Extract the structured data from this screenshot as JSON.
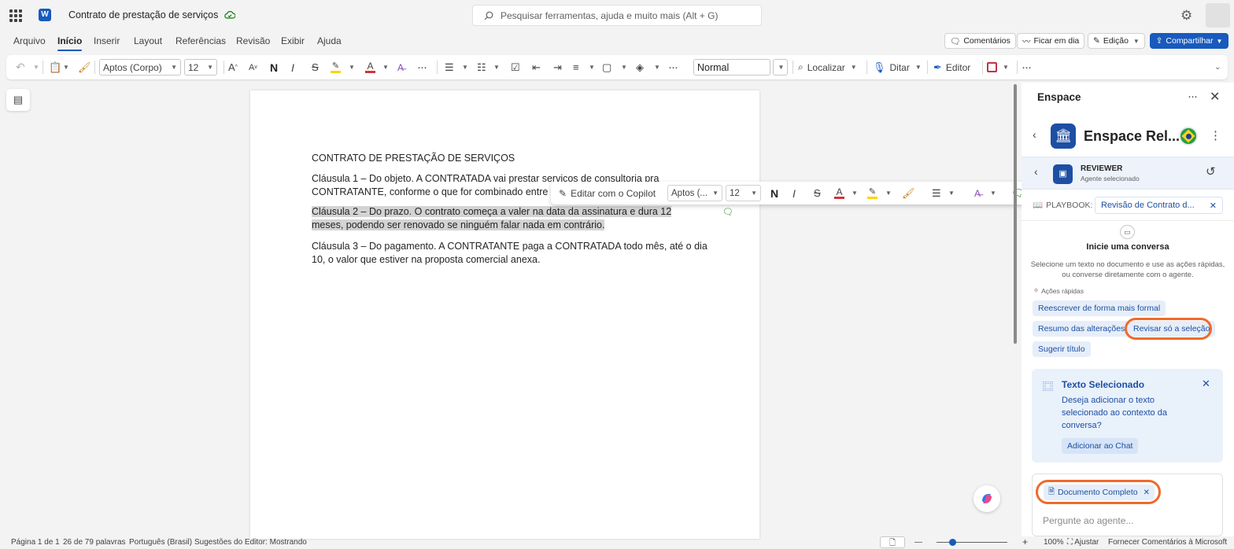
{
  "titlebar": {
    "doc_title": "Contrato de prestação de serviços",
    "search_placeholder": "Pesquisar ferramentas, ajuda e muito mais (Alt + G)"
  },
  "menu": {
    "tabs": [
      "Arquivo",
      "Início",
      "Inserir",
      "Layout",
      "Referências",
      "Revisão",
      "Exibir",
      "Ajuda"
    ],
    "active_tab": "Início",
    "comments_label": "Comentários",
    "catchup_label": "Ficar em dia",
    "editing_label": "Edição",
    "share_label": "Compartilhar"
  },
  "ribbon": {
    "font_name": "Aptos (Corpo)",
    "font_size": "12",
    "style": "Normal",
    "find_label": "Localizar",
    "dictate_label": "Ditar",
    "editor_label": "Editor"
  },
  "document": {
    "title": "CONTRATO DE PRESTAÇÃO DE SERVIÇOS",
    "p1_line1": "Cláusula 1 – Do objeto. A CONTRATADA vai prestar serviços de consultoria pra",
    "p1_line2": "CONTRATANTE, conforme o que for combinado entre as partes.",
    "p2_line1": "Cláusula 2 – Do prazo. O contrato começa a valer na data da assinatura e dura 12",
    "p2_line2": "meses, podendo ser renovado se ninguém falar nada em contrário.",
    "p3_line1": "Cláusula 3 – Do pagamento. A CONTRATANTE paga a CONTRATADA todo mês, até o dia",
    "p3_line2": "10, o valor que estiver na proposta comercial anexa."
  },
  "floating_toolbar": {
    "copilot_label": "Editar com o Copilot",
    "font_name": "Aptos (...",
    "font_size": "12"
  },
  "pane": {
    "title": "Enspace",
    "agent_name": "Enspace Rel...",
    "agent_role": "REVIEWER",
    "agent_sub": "Agente selecionado",
    "playbook_label": "PLAYBOOK:",
    "playbook_value": "Revisão de Contrato d...",
    "start_title": "Inicie uma conversa",
    "start_desc_1": "Selecione um texto no documento e use as ações rápidas,",
    "start_desc_2": "ou converse diretamente com o agente.",
    "quick_label": "Ações rápidas",
    "quick_actions": [
      "Reescrever de forma mais formal",
      "Resumo das alterações",
      "Revisar só a seleção",
      "Sugerir título"
    ],
    "sel_title": "Texto Selecionado",
    "sel_desc_1": "Deseja adicionar o texto",
    "sel_desc_2": "selecionado ao contexto da",
    "sel_desc_3": "conversa?",
    "add_chat": "Adicionar ao Chat",
    "doc_chip": "Documento Completo",
    "input_placeholder": "Pergunte ao agente..."
  },
  "status": {
    "page": "Página 1 de 1",
    "words": "26 de 79 palavras",
    "language": "Português (Brasil)",
    "suggestions": "Sugestões do Editor: Mostrando",
    "zoom": "100%",
    "fit": "Ajustar",
    "feedback": "Fornecer Comentários à Microsoft"
  },
  "colors": {
    "accent": "#185abd",
    "agent_blue": "#1e4fa3",
    "highlight_ring": "#ef6a2c",
    "selection_gray": "#d3d3d3"
  }
}
